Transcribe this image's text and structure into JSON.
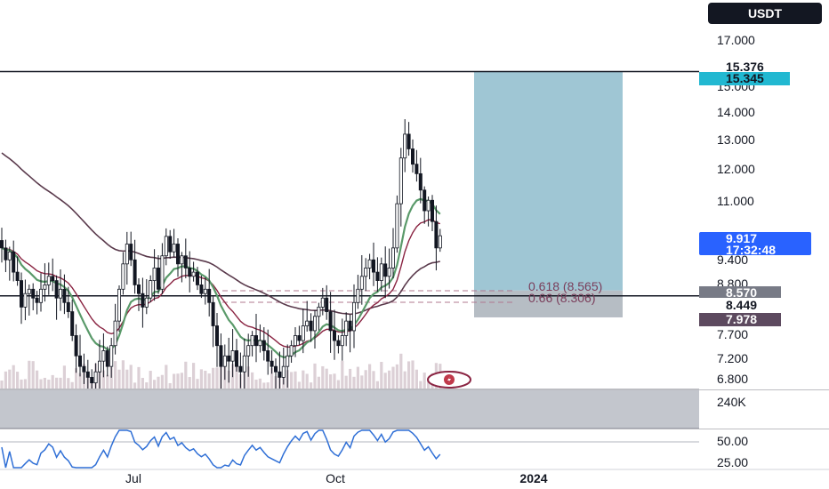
{
  "header": {
    "currency": "USDT"
  },
  "colors": {
    "background": "#ffffff",
    "text": "#131722",
    "candle": "#131722",
    "ema_fast": "#5a9a6a",
    "ema_slow": "#8a2442",
    "ma_long": "#5a3a4c",
    "rsi": "#2f6fd6",
    "zone_profit": "#7fb3c6",
    "zone_loss": "#9ea7b0",
    "badge_cyan": "#22b8d1",
    "badge_blue": "#2962ff",
    "badge_gray": "#787b86",
    "badge_dark": "#5d4a5f"
  },
  "price_axis": {
    "ticks": [
      "17.000",
      "15.000",
      "14.000",
      "13.000",
      "12.000",
      "11.000",
      "9.400",
      "8.800",
      "7.700",
      "7.200",
      "6.800"
    ]
  },
  "badges": {
    "resistance": "15.376",
    "target": "15.345",
    "current_price": "9.917",
    "countdown": "17:32:48",
    "entry": "8.570",
    "support": "8.449",
    "stop": "7.978"
  },
  "fib": {
    "level1": "0.618 (8.565)",
    "level2": "0.66 (8.306)"
  },
  "volume_axis": {
    "label": "240K"
  },
  "rsi_axis": {
    "ticks": [
      "50.00",
      "25.00"
    ]
  },
  "time_axis": {
    "labels": [
      "Jul",
      "Oct",
      "2024"
    ]
  },
  "chart_data": {
    "type": "candlestick",
    "title": "",
    "currency": "USDT",
    "scale": "log",
    "ylim": [
      6.6,
      18.5
    ],
    "horizontal_lines": [
      15.36,
      8.449
    ],
    "fib_levels": [
      {
        "label": "0.618 (8.565)",
        "value": 8.565
      },
      {
        "label": "0.66 (8.306)",
        "value": 8.306
      }
    ],
    "position": {
      "entry": 8.57,
      "target": 15.345,
      "stop": 7.978
    },
    "last_price": 9.917,
    "x_labels": [
      "Jul",
      "Oct",
      "2024"
    ],
    "close": [
      9.6,
      9.3,
      9.5,
      9.0,
      8.8,
      8.2,
      8.5,
      8.6,
      8.4,
      8.3,
      8.6,
      8.7,
      8.9,
      8.8,
      8.4,
      8.6,
      8.3,
      8.1,
      7.6,
      7.2,
      7.0,
      6.9,
      6.8,
      6.7,
      6.9,
      7.1,
      7.3,
      7.0,
      7.4,
      7.9,
      8.6,
      9.2,
      9.7,
      9.3,
      8.7,
      8.5,
      8.2,
      8.4,
      8.8,
      9.1,
      8.6,
      9.4,
      9.9,
      9.5,
      9.7,
      9.2,
      9.4,
      9.1,
      8.9,
      9.0,
      8.7,
      8.5,
      8.6,
      8.3,
      7.8,
      7.4,
      7.0,
      7.2,
      7.1,
      7.3,
      7.0,
      6.9,
      7.2,
      7.4,
      7.6,
      7.4,
      7.5,
      7.3,
      7.1,
      7.0,
      6.9,
      6.8,
      7.0,
      7.2,
      7.4,
      7.6,
      7.5,
      7.8,
      7.9,
      7.7,
      8.0,
      8.2,
      8.4,
      8.1,
      7.7,
      7.5,
      7.4,
      7.6,
      7.9,
      7.7,
      8.3,
      8.6,
      8.9,
      9.1,
      9.3,
      9.0,
      8.8,
      9.2,
      8.9,
      9.1,
      9.6,
      10.8,
      12.2,
      13.0,
      12.5,
      12.0,
      11.7,
      11.2,
      10.6,
      10.9,
      10.3,
      9.6,
      9.917
    ]
  }
}
